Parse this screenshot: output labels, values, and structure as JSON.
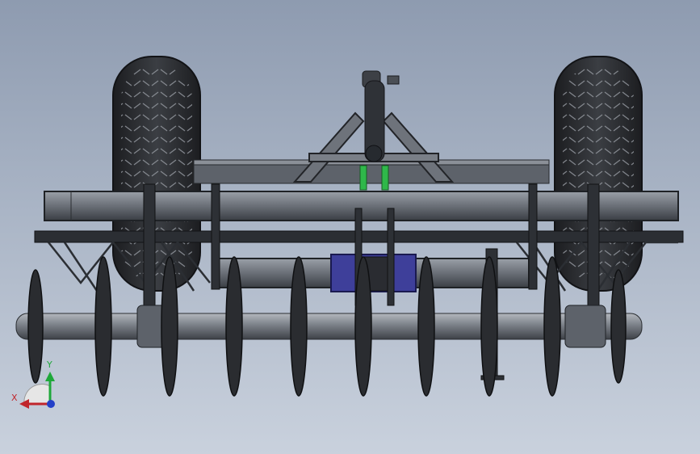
{
  "scene": {
    "kind": "cad-3d-viewport",
    "subject_icon": "disc-harrow-model",
    "colors": {
      "background_top": "#8e9bb0",
      "background_bottom": "#c9d1dd",
      "metal_dark": "#2e3136",
      "metal_mid": "#6d727b",
      "tire": "#2b2d31",
      "accent_blue": "#3e3f9a",
      "accent_green": "#2fb84a",
      "axis_x": "#c0262c",
      "axis_y": "#1fa83a",
      "axis_z": "#2340c8"
    }
  },
  "triad": {
    "x_label": "X",
    "y_label": "Y"
  }
}
